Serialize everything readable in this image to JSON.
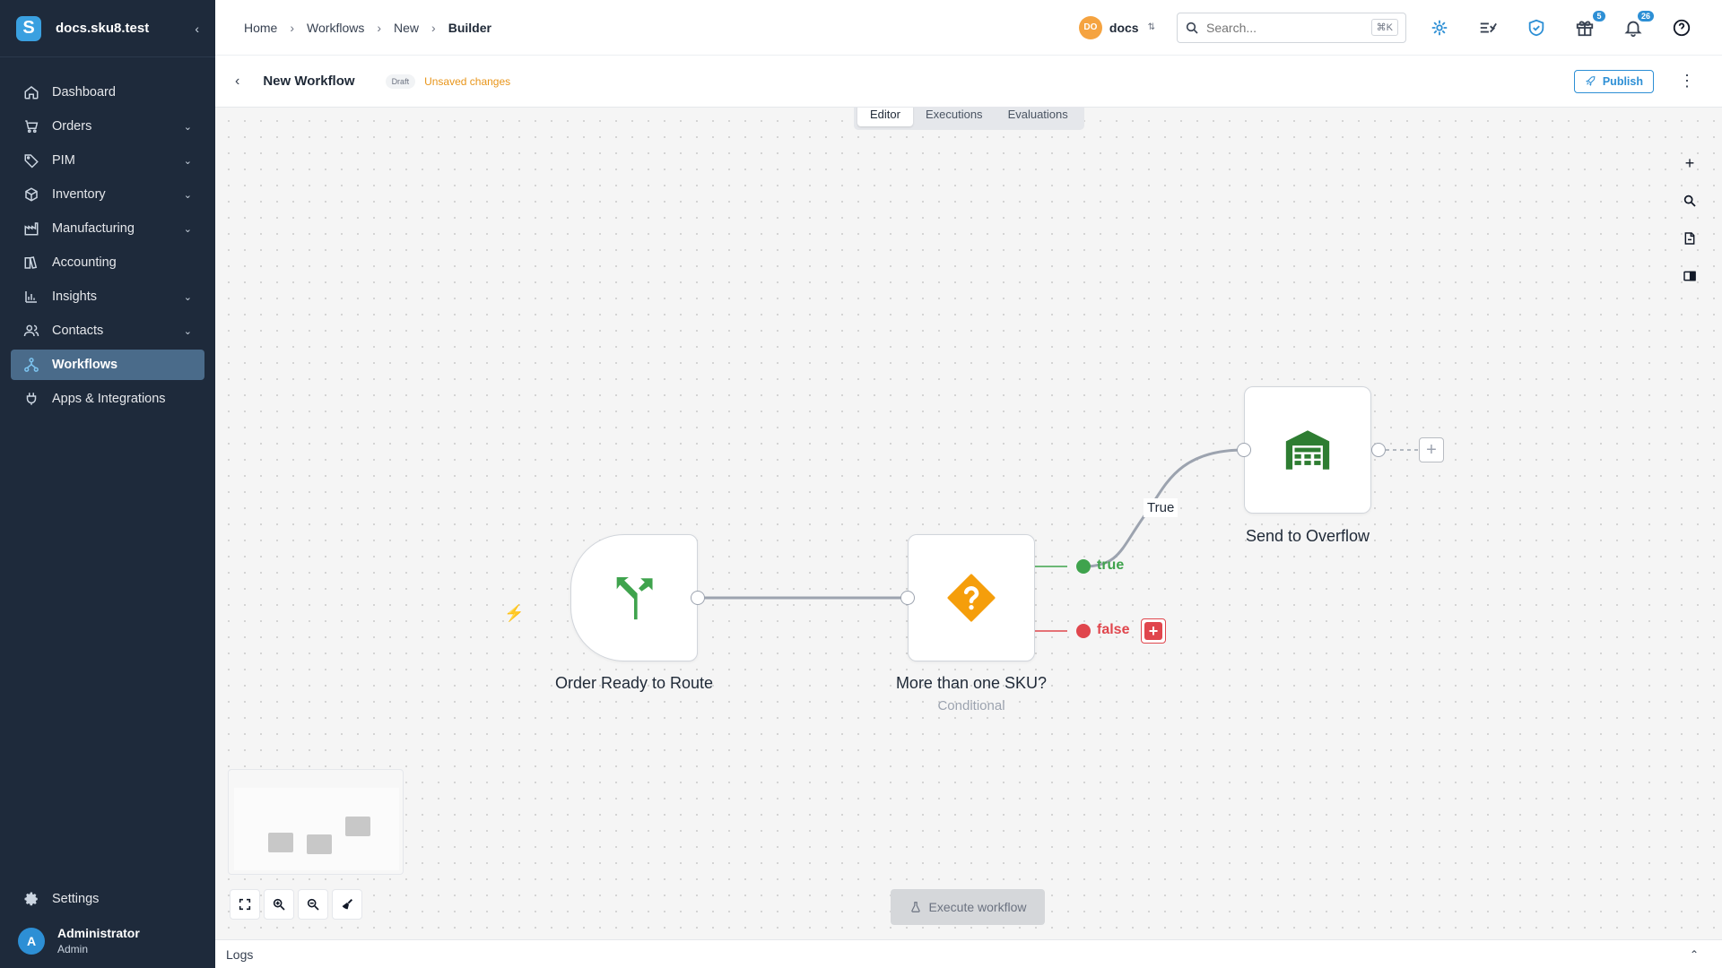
{
  "app": {
    "title": "docs.sku8.test",
    "logo_letter": "S",
    "collapse_glyph": "‹"
  },
  "nav": {
    "items": [
      {
        "label": "Dashboard",
        "icon": "home-icon"
      },
      {
        "label": "Orders",
        "icon": "cart-icon",
        "expandable": true
      },
      {
        "label": "PIM",
        "icon": "tag-icon",
        "expandable": true
      },
      {
        "label": "Inventory",
        "icon": "box-icon",
        "expandable": true
      },
      {
        "label": "Manufacturing",
        "icon": "factory-icon",
        "expandable": true
      },
      {
        "label": "Accounting",
        "icon": "book-icon"
      },
      {
        "label": "Insights",
        "icon": "bar-chart-icon",
        "expandable": true
      },
      {
        "label": "Contacts",
        "icon": "people-icon",
        "expandable": true
      },
      {
        "label": "Workflows",
        "icon": "workflow-icon",
        "active": true
      },
      {
        "label": "Apps & Integrations",
        "icon": "plug-icon"
      }
    ],
    "settings_label": "Settings"
  },
  "user": {
    "initial": "A",
    "name": "Administrator",
    "role": "Admin"
  },
  "breadcrumb": [
    "Home",
    "Workflows",
    "New",
    "Builder"
  ],
  "org": {
    "initials": "DO",
    "name": "docs"
  },
  "search": {
    "placeholder": "Search...",
    "shortcut": "⌘K"
  },
  "topbar_icons": {
    "gifts_badge": "5",
    "notifications_badge": "26"
  },
  "workflow": {
    "title": "New Workflow",
    "status": "Draft",
    "unsaved": "Unsaved changes",
    "publish_label": "Publish"
  },
  "tabs": [
    {
      "label": "Editor",
      "active": true
    },
    {
      "label": "Executions"
    },
    {
      "label": "Evaluations"
    }
  ],
  "nodes": {
    "trigger": {
      "label": "Order Ready to Route",
      "icon": "route-fork-icon",
      "color": "#3fa34d"
    },
    "conditional": {
      "label": "More than one SKU?",
      "sub": "Conditional",
      "icon": "question-diamond-icon",
      "color": "#f59e0b"
    },
    "action": {
      "label": "Send to Overflow",
      "icon": "warehouse-icon",
      "color": "#2e7d32"
    }
  },
  "branches": {
    "true_label": "true",
    "false_label": "false",
    "edge_label": "True",
    "true_color": "#3fa34d",
    "false_color": "#e0464d"
  },
  "canvas": {
    "execute_label": "Execute workflow"
  },
  "logs": {
    "label": "Logs"
  }
}
